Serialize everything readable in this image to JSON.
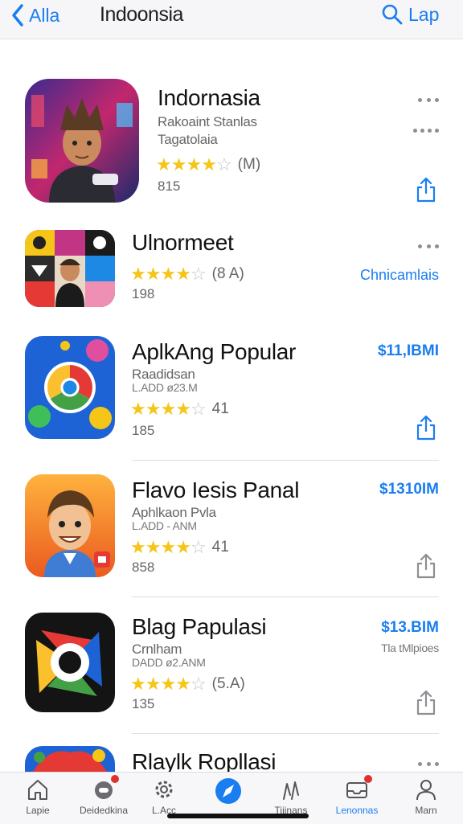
{
  "nav": {
    "back_label": "Alla",
    "title": "Indoonsia",
    "search_label": "Lap"
  },
  "apps": [
    {
      "name": "Indornasia",
      "subtitle1": "Rakoaint Stanlas",
      "subtitle2": "Tagatolaia",
      "stars": 4,
      "rating_count": "(M)",
      "size": "815",
      "right_action": "",
      "show_share": true
    },
    {
      "name": "Ulnormeet",
      "subtitle1": "",
      "subtitle2": "",
      "stars": 4,
      "rating_count": "(8 A)",
      "size": "198",
      "right_action": "Chnicamlais",
      "show_share": false
    },
    {
      "name": "AplkAng Popular",
      "subtitle1": "Raadidsan",
      "subtitle2": "L.ADD ø23.M",
      "stars": 4,
      "rating_count": "41",
      "size": "185",
      "price": "$11,IBMI",
      "show_share": true
    },
    {
      "name": "Flavo Iesis Panal",
      "subtitle1": "Aphlkaon Pvla",
      "subtitle2": "L.ADD - ANM",
      "stars": 4,
      "rating_count": "41",
      "size": "858",
      "price": "$1310IM",
      "show_share": true
    },
    {
      "name": "Blag Papulasi",
      "subtitle1": "Crnlham",
      "subtitle2": "DADD ø2.ANM",
      "stars": 4,
      "rating_count": "(5.A)",
      "size": "135",
      "price": "$13.BIM",
      "price_note": "Tla tMlpioes",
      "show_share": true
    },
    {
      "name": "Rlaylk Ropllasi"
    }
  ],
  "tabs": [
    {
      "label": "Lapie",
      "icon": "home-icon"
    },
    {
      "label": "Deidedkina",
      "icon": "games-icon"
    },
    {
      "label": "L.Acc",
      "icon": "settings-icon"
    },
    {
      "label": "",
      "icon": "compass-icon"
    },
    {
      "label": "Tijinans",
      "icon": "people-icon"
    },
    {
      "label": "Lenonnas",
      "icon": "inbox-icon"
    },
    {
      "label": "Marn",
      "icon": "account-icon"
    }
  ],
  "colors": {
    "accent": "#1a7ef0",
    "star": "#f5c518",
    "badge": "#e0312f"
  }
}
